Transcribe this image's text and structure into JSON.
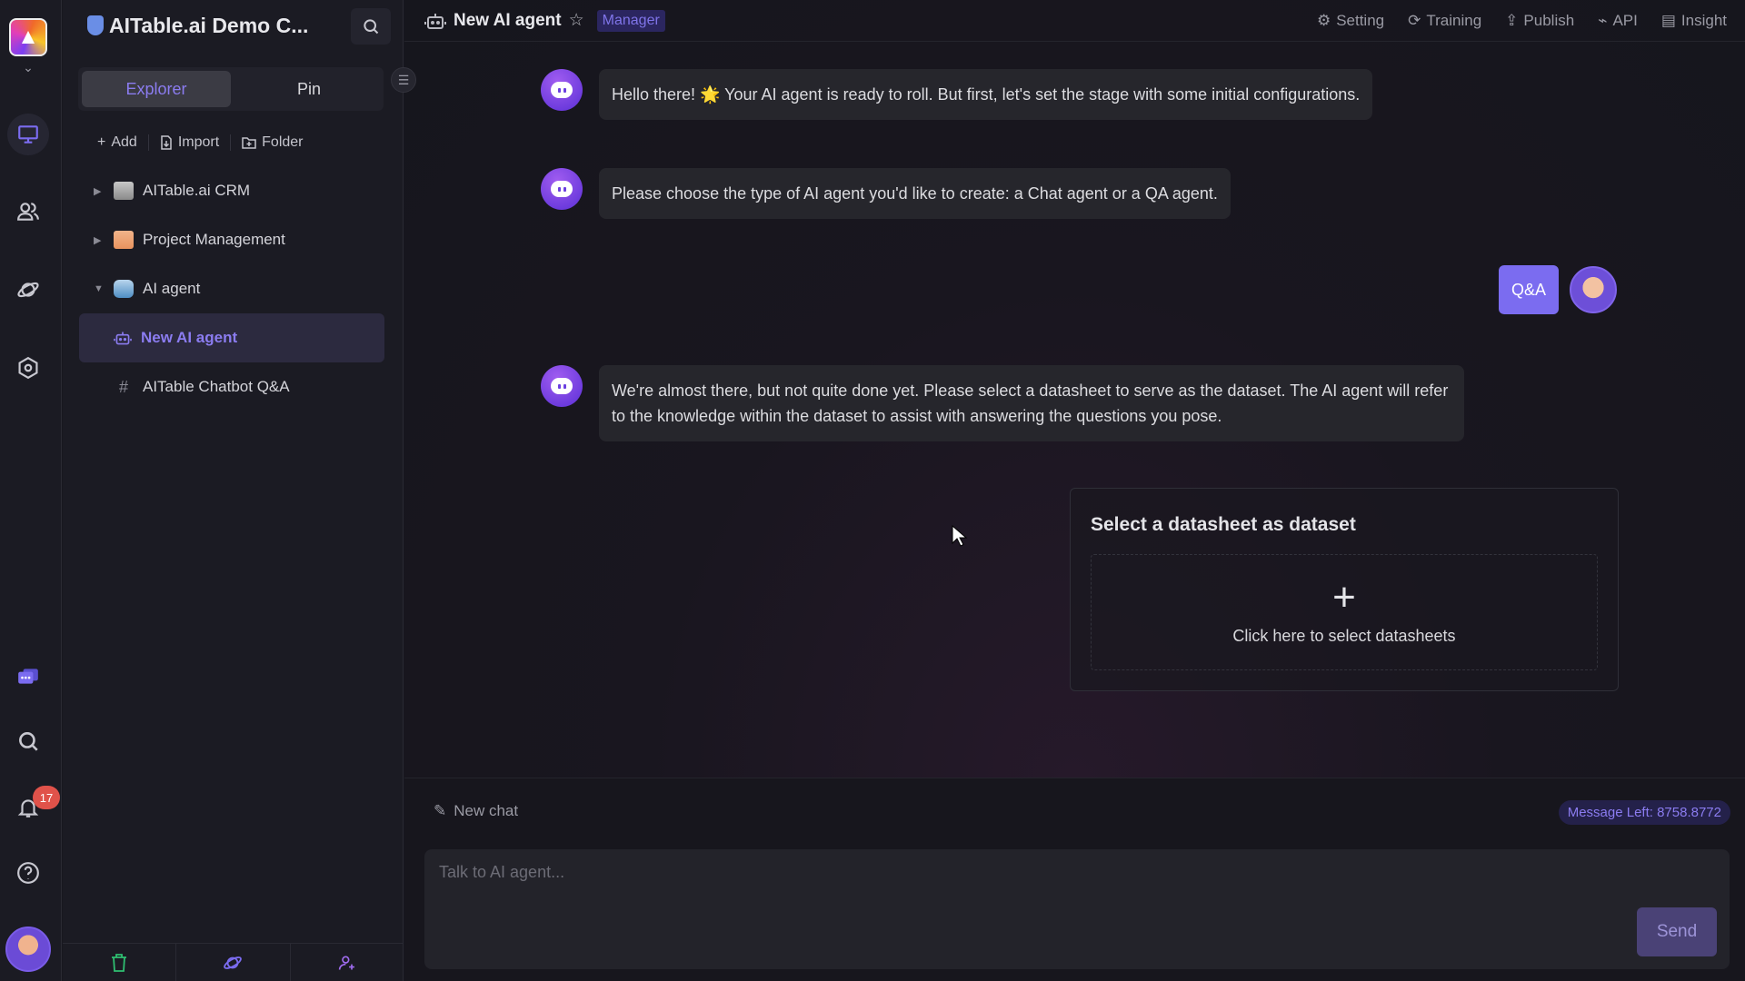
{
  "rail": {
    "icons": [
      "workbench-icon",
      "contacts-icon",
      "explore-icon",
      "settings-icon",
      "ai-chat-icon",
      "search-icon",
      "notification-icon",
      "help-icon"
    ],
    "notification_count": "17",
    "accent": "#7b6cf0"
  },
  "workspace": {
    "name": "AITable.ai Demo C...",
    "tabs": [
      {
        "label": "Explorer",
        "active": true
      },
      {
        "label": "Pin",
        "active": false
      }
    ],
    "actions": [
      {
        "label": "Add",
        "icon": "plus-icon"
      },
      {
        "label": "Import",
        "icon": "import-icon"
      },
      {
        "label": "Folder",
        "icon": "folder-icon"
      }
    ],
    "tree": [
      {
        "label": "AITable.ai CRM",
        "type": "folder",
        "expanded": false
      },
      {
        "label": "Project Management",
        "type": "folder",
        "expanded": false
      },
      {
        "label": "AI agent",
        "type": "folder",
        "expanded": true
      },
      {
        "label": "New AI agent",
        "type": "ai-agent",
        "selected": true
      },
      {
        "label": "AITable Chatbot Q&A",
        "type": "datasheet",
        "selected": false
      }
    ]
  },
  "header": {
    "title": "New AI agent",
    "role": "Manager",
    "actions": [
      {
        "label": "Setting",
        "icon": "gear-icon"
      },
      {
        "label": "Training",
        "icon": "training-icon"
      },
      {
        "label": "Publish",
        "icon": "publish-icon"
      },
      {
        "label": "API",
        "icon": "api-icon"
      },
      {
        "label": "Insight",
        "icon": "insight-icon"
      }
    ]
  },
  "chat": {
    "messages": [
      {
        "from": "bot",
        "text": "Hello there! 🌟 Your AI agent is ready to roll. But first, let's set the stage with some initial configurations."
      },
      {
        "from": "bot",
        "text": "Please choose the type of AI agent you'd like to create: a Chat agent or a QA agent."
      },
      {
        "from": "user",
        "text": "Q&A"
      },
      {
        "from": "bot",
        "text": "We're almost there, but not quite done yet. Please select a datasheet to serve as the dataset. The AI agent will refer to the knowledge within the dataset to assist with answering the questions you pose."
      }
    ],
    "dataset_card": {
      "title": "Select a datasheet as dataset",
      "hint": "Click here to select datasheets"
    }
  },
  "composer": {
    "new_chat_label": "New chat",
    "message_left": "Message Left: 8758.8772",
    "placeholder": "Talk to AI agent...",
    "value": "",
    "send_label": "Send"
  }
}
